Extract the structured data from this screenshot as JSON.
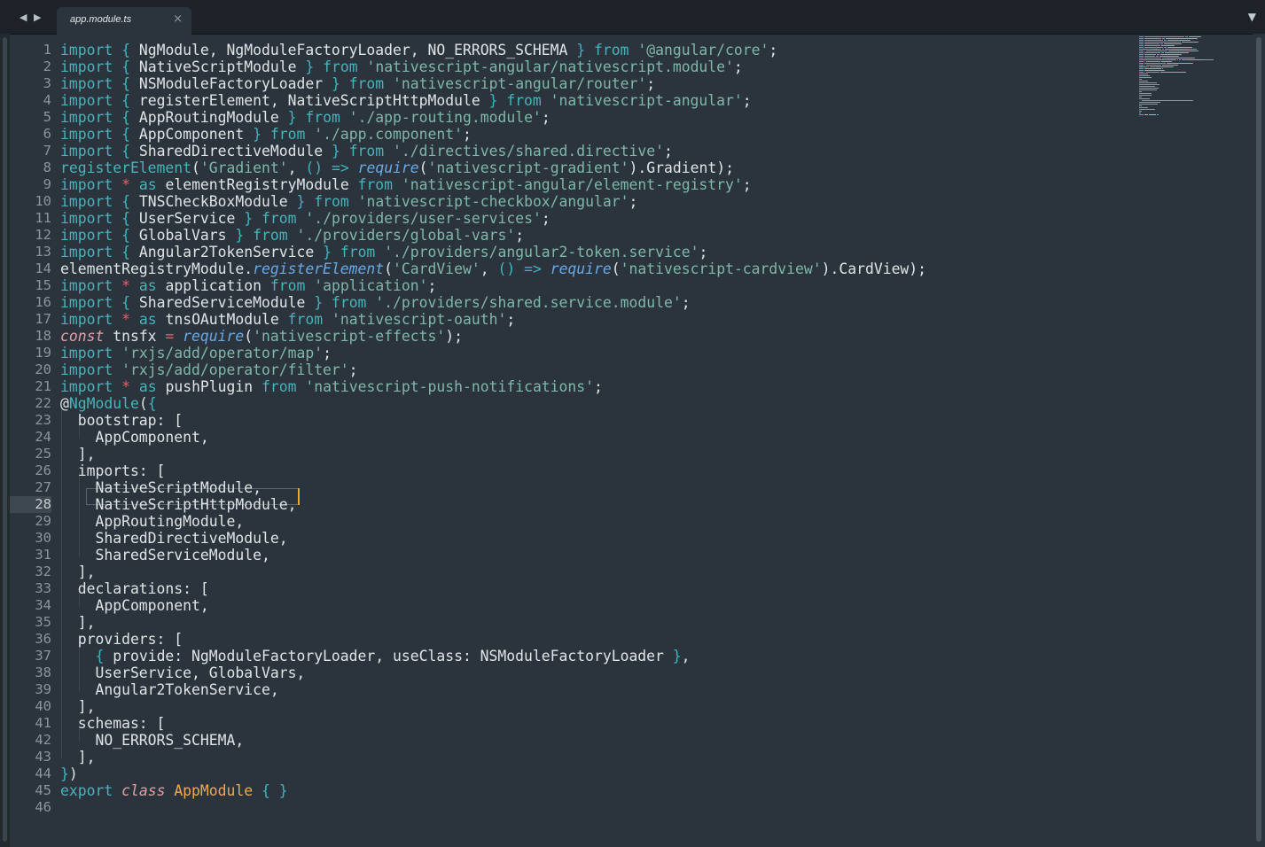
{
  "tabbar": {
    "nav_arrows": "◀ ▶",
    "tab_title": "app.module.ts",
    "tab_close": "×",
    "dropdown": "▼"
  },
  "editor": {
    "active_line": 28,
    "lines": [
      [
        [
          "k",
          "import"
        ],
        [
          "t",
          " "
        ],
        [
          "p",
          "{"
        ],
        [
          "t",
          " NgModule, NgModuleFactoryLoader, NO_ERRORS_SCHEMA "
        ],
        [
          "p",
          "}"
        ],
        [
          "t",
          " "
        ],
        [
          "k",
          "from"
        ],
        [
          "t",
          " "
        ],
        [
          "s",
          "'@angular/core'"
        ],
        [
          "t",
          ";"
        ]
      ],
      [
        [
          "k",
          "import"
        ],
        [
          "t",
          " "
        ],
        [
          "p",
          "{"
        ],
        [
          "t",
          " NativeScriptModule "
        ],
        [
          "p",
          "}"
        ],
        [
          "t",
          " "
        ],
        [
          "k",
          "from"
        ],
        [
          "t",
          " "
        ],
        [
          "s",
          "'nativescript-angular/nativescript.module'"
        ],
        [
          "t",
          ";"
        ]
      ],
      [
        [
          "k",
          "import"
        ],
        [
          "t",
          " "
        ],
        [
          "p",
          "{"
        ],
        [
          "t",
          " NSModuleFactoryLoader "
        ],
        [
          "p",
          "}"
        ],
        [
          "t",
          " "
        ],
        [
          "k",
          "from"
        ],
        [
          "t",
          " "
        ],
        [
          "s",
          "'nativescript-angular/router'"
        ],
        [
          "t",
          ";"
        ]
      ],
      [
        [
          "k",
          "import"
        ],
        [
          "t",
          " "
        ],
        [
          "p",
          "{"
        ],
        [
          "t",
          " registerElement, NativeScriptHttpModule "
        ],
        [
          "p",
          "}"
        ],
        [
          "t",
          " "
        ],
        [
          "k",
          "from"
        ],
        [
          "t",
          " "
        ],
        [
          "s",
          "'nativescript-angular'"
        ],
        [
          "t",
          ";"
        ]
      ],
      [
        [
          "k",
          "import"
        ],
        [
          "t",
          " "
        ],
        [
          "p",
          "{"
        ],
        [
          "t",
          " AppRoutingModule "
        ],
        [
          "p",
          "}"
        ],
        [
          "t",
          " "
        ],
        [
          "k",
          "from"
        ],
        [
          "t",
          " "
        ],
        [
          "s",
          "'./app-routing.module'"
        ],
        [
          "t",
          ";"
        ]
      ],
      [
        [
          "k",
          "import"
        ],
        [
          "t",
          " "
        ],
        [
          "p",
          "{"
        ],
        [
          "t",
          " AppComponent "
        ],
        [
          "p",
          "}"
        ],
        [
          "t",
          " "
        ],
        [
          "k",
          "from"
        ],
        [
          "t",
          " "
        ],
        [
          "s",
          "'./app.component'"
        ],
        [
          "t",
          ";"
        ]
      ],
      [
        [
          "k",
          "import"
        ],
        [
          "t",
          " "
        ],
        [
          "p",
          "{"
        ],
        [
          "t",
          " SharedDirectiveModule "
        ],
        [
          "p",
          "}"
        ],
        [
          "t",
          " "
        ],
        [
          "k",
          "from"
        ],
        [
          "t",
          " "
        ],
        [
          "s",
          "'./directives/shared.directive'"
        ],
        [
          "t",
          ";"
        ]
      ],
      [
        [
          "k",
          "registerElement"
        ],
        [
          "t",
          "("
        ],
        [
          "s",
          "'Gradient'"
        ],
        [
          "t",
          ", "
        ],
        [
          "p",
          "()"
        ],
        [
          "t",
          " "
        ],
        [
          "p",
          "=>"
        ],
        [
          "t",
          " "
        ],
        [
          "f",
          "require"
        ],
        [
          "t",
          "("
        ],
        [
          "s",
          "'nativescript-gradient'"
        ],
        [
          "t",
          ").Gradient);"
        ]
      ],
      [
        [
          "k",
          "import"
        ],
        [
          "t",
          " "
        ],
        [
          "r",
          "*"
        ],
        [
          "t",
          " "
        ],
        [
          "k",
          "as"
        ],
        [
          "t",
          " elementRegistryModule "
        ],
        [
          "k",
          "from"
        ],
        [
          "t",
          " "
        ],
        [
          "s",
          "'nativescript-angular/element-registry'"
        ],
        [
          "t",
          ";"
        ]
      ],
      [
        [
          "k",
          "import"
        ],
        [
          "t",
          " "
        ],
        [
          "p",
          "{"
        ],
        [
          "t",
          " TNSCheckBoxModule "
        ],
        [
          "p",
          "}"
        ],
        [
          "t",
          " "
        ],
        [
          "k",
          "from"
        ],
        [
          "t",
          " "
        ],
        [
          "s",
          "'nativescript-checkbox/angular'"
        ],
        [
          "t",
          ";"
        ]
      ],
      [
        [
          "k",
          "import"
        ],
        [
          "t",
          " "
        ],
        [
          "p",
          "{"
        ],
        [
          "t",
          " UserService "
        ],
        [
          "p",
          "}"
        ],
        [
          "t",
          " "
        ],
        [
          "k",
          "from"
        ],
        [
          "t",
          " "
        ],
        [
          "s",
          "'./providers/user-services'"
        ],
        [
          "t",
          ";"
        ]
      ],
      [
        [
          "k",
          "import"
        ],
        [
          "t",
          " "
        ],
        [
          "p",
          "{"
        ],
        [
          "t",
          " GlobalVars "
        ],
        [
          "p",
          "}"
        ],
        [
          "t",
          " "
        ],
        [
          "k",
          "from"
        ],
        [
          "t",
          " "
        ],
        [
          "s",
          "'./providers/global-vars'"
        ],
        [
          "t",
          ";"
        ]
      ],
      [
        [
          "k",
          "import"
        ],
        [
          "t",
          " "
        ],
        [
          "p",
          "{"
        ],
        [
          "t",
          " Angular2TokenService "
        ],
        [
          "p",
          "}"
        ],
        [
          "t",
          " "
        ],
        [
          "k",
          "from"
        ],
        [
          "t",
          " "
        ],
        [
          "s",
          "'./providers/angular2-token.service'"
        ],
        [
          "t",
          ";"
        ]
      ],
      [
        [
          "t",
          "elementRegistryModule."
        ],
        [
          "f",
          "registerElement"
        ],
        [
          "t",
          "("
        ],
        [
          "s",
          "'CardView'"
        ],
        [
          "t",
          ", "
        ],
        [
          "p",
          "()"
        ],
        [
          "t",
          " "
        ],
        [
          "p",
          "=>"
        ],
        [
          "t",
          " "
        ],
        [
          "f",
          "require"
        ],
        [
          "t",
          "("
        ],
        [
          "s",
          "'nativescript-cardview'"
        ],
        [
          "t",
          ").CardView);"
        ]
      ],
      [
        [
          "k",
          "import"
        ],
        [
          "t",
          " "
        ],
        [
          "r",
          "*"
        ],
        [
          "t",
          " "
        ],
        [
          "k",
          "as"
        ],
        [
          "t",
          " application "
        ],
        [
          "k",
          "from"
        ],
        [
          "t",
          " "
        ],
        [
          "s",
          "'application'"
        ],
        [
          "t",
          ";"
        ]
      ],
      [
        [
          "k",
          "import"
        ],
        [
          "t",
          " "
        ],
        [
          "p",
          "{"
        ],
        [
          "t",
          " SharedServiceModule "
        ],
        [
          "p",
          "}"
        ],
        [
          "t",
          " "
        ],
        [
          "k",
          "from"
        ],
        [
          "t",
          " "
        ],
        [
          "s",
          "'./providers/shared.service.module'"
        ],
        [
          "t",
          ";"
        ]
      ],
      [
        [
          "k",
          "import"
        ],
        [
          "t",
          " "
        ],
        [
          "r",
          "*"
        ],
        [
          "t",
          " "
        ],
        [
          "k",
          "as"
        ],
        [
          "t",
          " tnsOAutModule "
        ],
        [
          "k",
          "from"
        ],
        [
          "t",
          " "
        ],
        [
          "s",
          "'nativescript-oauth'"
        ],
        [
          "t",
          ";"
        ]
      ],
      [
        [
          "i",
          "const"
        ],
        [
          "t",
          " tnsfx "
        ],
        [
          "r",
          "="
        ],
        [
          "t",
          " "
        ],
        [
          "f",
          "require"
        ],
        [
          "t",
          "("
        ],
        [
          "s",
          "'nativescript-effects'"
        ],
        [
          "t",
          ");"
        ]
      ],
      [
        [
          "k",
          "import"
        ],
        [
          "t",
          " "
        ],
        [
          "s",
          "'rxjs/add/operator/map'"
        ],
        [
          "t",
          ";"
        ]
      ],
      [
        [
          "k",
          "import"
        ],
        [
          "t",
          " "
        ],
        [
          "s",
          "'rxjs/add/operator/filter'"
        ],
        [
          "t",
          ";"
        ]
      ],
      [
        [
          "k",
          "import"
        ],
        [
          "t",
          " "
        ],
        [
          "r",
          "*"
        ],
        [
          "t",
          " "
        ],
        [
          "k",
          "as"
        ],
        [
          "t",
          " pushPlugin "
        ],
        [
          "k",
          "from"
        ],
        [
          "t",
          " "
        ],
        [
          "s",
          "'nativescript-push-notifications'"
        ],
        [
          "t",
          ";"
        ]
      ],
      [
        [
          "t",
          "@"
        ],
        [
          "k",
          "NgModule"
        ],
        [
          "t",
          "("
        ],
        [
          "p",
          "{"
        ]
      ],
      [
        [
          "t",
          "  bootstrap: ["
        ]
      ],
      [
        [
          "t",
          "    AppComponent,"
        ]
      ],
      [
        [
          "t",
          "  ],"
        ]
      ],
      [
        [
          "t",
          "  imports: ["
        ]
      ],
      [
        [
          "t",
          "    NativeScriptModule,"
        ]
      ],
      [
        [
          "t",
          "    NativeScriptHttpModule,"
        ]
      ],
      [
        [
          "t",
          "    AppRoutingModule,"
        ]
      ],
      [
        [
          "t",
          "    SharedDirectiveModule,"
        ]
      ],
      [
        [
          "t",
          "    SharedServiceModule,"
        ]
      ],
      [
        [
          "t",
          "  ],"
        ]
      ],
      [
        [
          "t",
          "  declarations: ["
        ]
      ],
      [
        [
          "t",
          "    AppComponent,"
        ]
      ],
      [
        [
          "t",
          "  ],"
        ]
      ],
      [
        [
          "t",
          "  providers: ["
        ]
      ],
      [
        [
          "t",
          "    "
        ],
        [
          "p",
          "{"
        ],
        [
          "t",
          " provide: NgModuleFactoryLoader, useClass: NSModuleFactoryLoader "
        ],
        [
          "p",
          "}"
        ],
        [
          "t",
          ","
        ]
      ],
      [
        [
          "t",
          "    UserService, GlobalVars,"
        ]
      ],
      [
        [
          "t",
          "    Angular2TokenService,"
        ]
      ],
      [
        [
          "t",
          "  ],"
        ]
      ],
      [
        [
          "t",
          "  schemas: ["
        ]
      ],
      [
        [
          "t",
          "    NO_ERRORS_SCHEMA,"
        ]
      ],
      [
        [
          "t",
          "  ],"
        ]
      ],
      [
        [
          "p",
          "}"
        ],
        [
          "t",
          ")"
        ]
      ],
      [
        [
          "k",
          "export"
        ],
        [
          "t",
          " "
        ],
        [
          "i",
          "class"
        ],
        [
          "t",
          " "
        ],
        [
          "c",
          "AppModule"
        ],
        [
          "t",
          " "
        ],
        [
          "p",
          "{ }"
        ]
      ],
      []
    ]
  }
}
